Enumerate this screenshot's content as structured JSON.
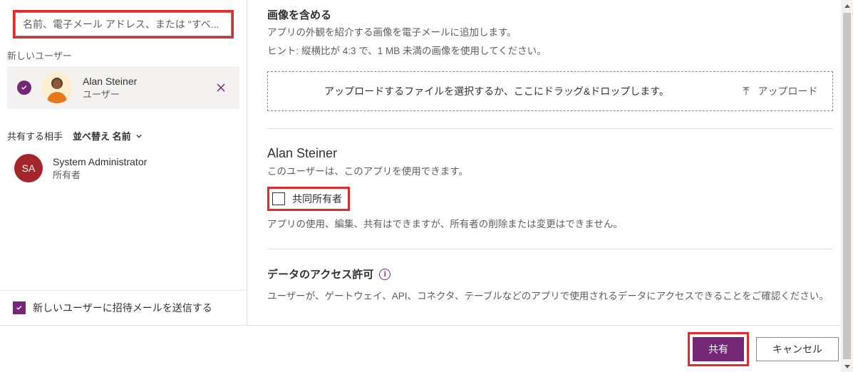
{
  "left": {
    "search_placeholder": "名前、電子メール アドレス、または \"すべ...",
    "new_user_label": "新しいユーザー",
    "selected_user": {
      "name": "Alan Steiner",
      "role": "ユーザー"
    },
    "share_with_label": "共有する相手",
    "sort_label": "並べ替え 名前",
    "owner": {
      "initials": "SA",
      "name": "System Administrator",
      "role": "所有者"
    },
    "invite_checkbox_label": "新しいユーザーに招待メールを送信する"
  },
  "right": {
    "image_section": {
      "title": "画像を含める",
      "desc": "アプリの外観を紹介する画像を電子メールに追加します。",
      "hint": "ヒント: 縦横比が 4:3 で、1 MB 未満の画像を使用してください。",
      "drop_text": "アップロードするファイルを選択するか、ここにドラッグ&ドロップします。",
      "upload_label": "アップロード"
    },
    "user_section": {
      "name": "Alan Steiner",
      "desc": "このユーザーは、このアプリを使用できます。",
      "coowner_label": "共同所有者",
      "coowner_desc": "アプリの使用、編集、共有はできますが、所有者の削除または変更はできません。"
    },
    "perm_section": {
      "title": "データのアクセス許可",
      "desc": "ユーザーが、ゲートウェイ、API、コネクタ、テーブルなどのアプリで使用されるデータにアクセスできることをご確認ください。"
    }
  },
  "footer": {
    "share": "共有",
    "cancel": "キャンセル"
  }
}
